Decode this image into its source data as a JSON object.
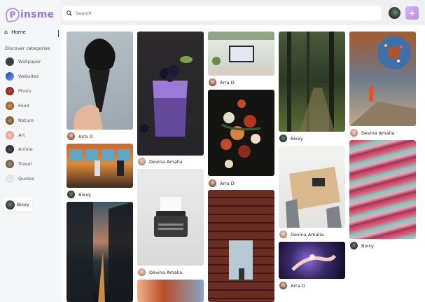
{
  "app": {
    "logo_initial": "P",
    "logo_rest": "insme"
  },
  "sidebar": {
    "home_label": "Home",
    "discover_label": "Discover categories",
    "categories": [
      {
        "label": "Wallpaper",
        "color": "#3a3f45"
      },
      {
        "label": "Websites",
        "color": "#1f3f8a"
      },
      {
        "label": "Photo",
        "color": "#7b2b1d"
      },
      {
        "label": "Food",
        "color": "#8a5a2b"
      },
      {
        "label": "Nature",
        "color": "#6b4a2d"
      },
      {
        "label": "Art",
        "color": "#e9b5a6"
      },
      {
        "label": "Anime",
        "color": "#222222"
      },
      {
        "label": "Travel",
        "color": "#6a5a4a"
      },
      {
        "label": "Quotes",
        "color": "#e7e7e7"
      }
    ],
    "current_user": "Bixxy"
  },
  "search": {
    "placeholder": "Search"
  },
  "colors": {
    "accent": "#b98ee8",
    "logo": "#8f7ad8"
  },
  "pins": [
    {
      "author": "Arra D",
      "subject": "black-ice-cream-cone"
    },
    {
      "author": "Bixxy",
      "subject": "anime-train-scene"
    },
    {
      "author": "",
      "subject": "city-alley-sunset"
    },
    {
      "author": "Devina Amalia",
      "subject": "berry-lemonade-drink"
    },
    {
      "author": "Devina Amalia",
      "subject": "typewriter"
    },
    {
      "author": "",
      "subject": "anime-character"
    },
    {
      "author": "Arra D",
      "subject": "desk-workspace"
    },
    {
      "author": "Arra D",
      "subject": "flower-painting"
    },
    {
      "author": "",
      "subject": "library-bookshelves"
    },
    {
      "author": "Bixxy",
      "subject": "forest-path"
    },
    {
      "author": "Devina Amalia",
      "subject": "dining-table"
    },
    {
      "author": "Arra D",
      "subject": "anime-hand"
    },
    {
      "author": "Devina Amalia",
      "subject": "donut-mural"
    },
    {
      "author": "Bixxy",
      "subject": "colorful-waves"
    }
  ]
}
